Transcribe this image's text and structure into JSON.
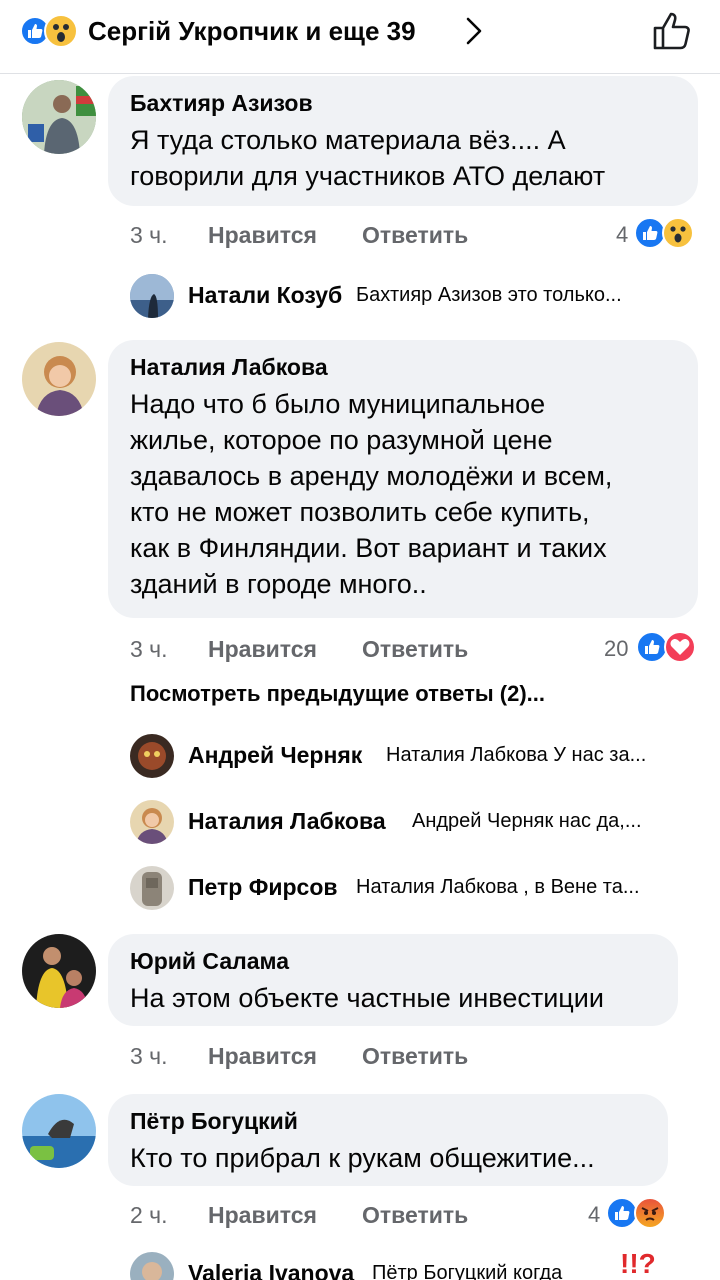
{
  "header": {
    "title": "Сергій Укропчик и еще 39",
    "reactions": [
      "like-icon",
      "wow-icon"
    ]
  },
  "comments": [
    {
      "name": "Бахтияр Азизов",
      "text_lines": [
        "Я туда столько материала вёз.... А",
        "говорили для участников АТО делают"
      ],
      "time": "3 ч.",
      "like_label": "Нравится",
      "reply_label": "Ответить",
      "reaction_count": "4",
      "reactions": [
        "like-icon",
        "wow-icon"
      ],
      "replies": [
        {
          "name": "Натали Козуб",
          "text": "Бахтияр Азизов это только..."
        }
      ]
    },
    {
      "name": "Наталия Лабкова",
      "text_lines": [
        "Надо что б было муниципальное",
        "жилье, которое по разумной цене",
        "здавалось в аренду молодёжи и всем,",
        "кто не может позволить себе купить,",
        "как в Финляндии. Вот вариант и таких",
        "зданий в городе много.."
      ],
      "time": "3 ч.",
      "like_label": "Нравится",
      "reply_label": "Ответить",
      "reaction_count": "20",
      "reactions": [
        "like-icon",
        "love-icon"
      ],
      "previous_replies": "Посмотреть предыдущие ответы (2)...",
      "replies": [
        {
          "name": "Андрей Черняк",
          "text": "Наталия Лабкова У нас за..."
        },
        {
          "name": "Наталия Лабкова",
          "text": "Андрей Черняк нас да,..."
        },
        {
          "name": "Петр Фирсов",
          "text": "Наталия Лабкова , в Вене та..."
        }
      ]
    },
    {
      "name": "Юрий Салама",
      "text_lines": [
        "На этом объекте частные инвестиции"
      ],
      "time": "3 ч.",
      "like_label": "Нравится",
      "reply_label": "Ответить"
    },
    {
      "name": "Пётр Богуцкий",
      "text_lines": [
        "Кто то прибрал к рукам общежитие..."
      ],
      "time": "2 ч.",
      "like_label": "Нравится",
      "reply_label": "Ответить",
      "reaction_count": "4",
      "reactions": [
        "like-icon",
        "angry-icon"
      ],
      "replies": [
        {
          "name": "Valeria Ivanova",
          "text": "Пётр Богуцкий когда",
          "sticker": "!!?"
        }
      ]
    }
  ]
}
